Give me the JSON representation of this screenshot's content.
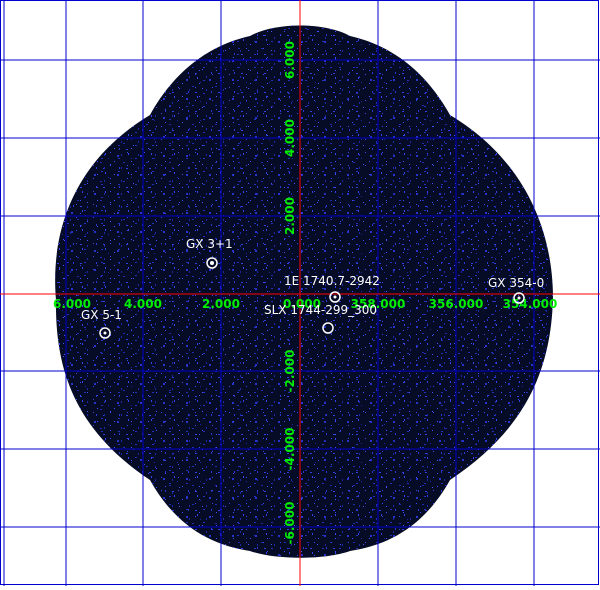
{
  "colors": {
    "background": "#ffffff",
    "field": "#060b26",
    "grid": "#0000cc",
    "axis": "#ff0000",
    "tick_label": "#00ee00",
    "source_marker": "#ffffff"
  },
  "grid": {
    "lon_labels": [
      "6.000",
      "4.000",
      "2.000",
      "0.000",
      "358.000",
      "356.000",
      "354.000"
    ],
    "lat_labels": [
      "6.000",
      "4.000",
      "2.000",
      "-2.000",
      "-4.000",
      "-6.000"
    ]
  },
  "sources": [
    {
      "name": "GX 3+1",
      "marker_icon": "circle-marker-icon"
    },
    {
      "name": "1E 1740.7-2942",
      "marker_icon": "circle-marker-icon"
    },
    {
      "name": "GX 354-0",
      "marker_icon": "circle-marker-icon"
    },
    {
      "name": "GX 5-1",
      "marker_icon": "circle-marker-icon"
    },
    {
      "name": "SLX 1744-299_300",
      "marker_icon": "circle-marker-icon"
    }
  ]
}
